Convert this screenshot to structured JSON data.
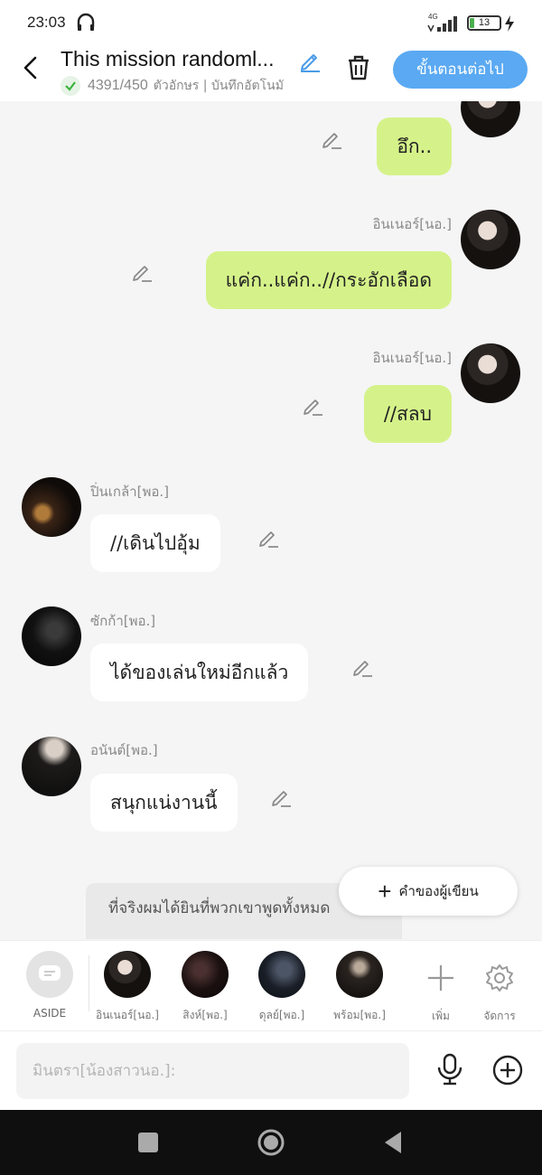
{
  "status": {
    "time": "23:03",
    "network": "4G",
    "battery": "13"
  },
  "header": {
    "title": "This mission randoml...",
    "char_count": "4391/450",
    "meta": "ตัวอักษร | บันทึกอัตโนมั",
    "next_label": "ขั้นตอนต่อไป"
  },
  "messages": [
    {
      "side": "out",
      "name": "",
      "text": "อึก.."
    },
    {
      "side": "out",
      "name": "อินเนอร์[นอ.]",
      "text": "แค่ก..แค่ก..//กระอักเลือด"
    },
    {
      "side": "out",
      "name": "อินเนอร์[นอ.]",
      "text": "//สลบ"
    },
    {
      "side": "in",
      "name": "ปิ่นเกล้า[พอ.]",
      "text": "//เดินไปอุ้ม"
    },
    {
      "side": "in",
      "name": "ซักก้า[พอ.]",
      "text": "ได้ของเล่นใหม่อีกแล้ว"
    },
    {
      "side": "in",
      "name": "อนันต์[พอ.]",
      "text": "สนุกแน่งานนี้"
    }
  ],
  "narration": "ที่จริงผมได้ยินที่พวกเขาพูดทั้งหมด",
  "author_button": "คำของผู้เขียน",
  "characters": {
    "aside": "ASIDE",
    "list": [
      "อินเนอร์[นอ.]",
      "สิงห์[พอ.]",
      "ดุลย์[พอ.]",
      "พร้อม[พอ.]"
    ],
    "add": "เพิ่ม",
    "manage": "จัดการ"
  },
  "input": {
    "placeholder": "มินตรา[น้องสาวนอ.]:"
  },
  "colors": {
    "accent": "#5aa9f2",
    "out_bubble": "#d5f28a",
    "in_bubble": "#ffffff"
  }
}
